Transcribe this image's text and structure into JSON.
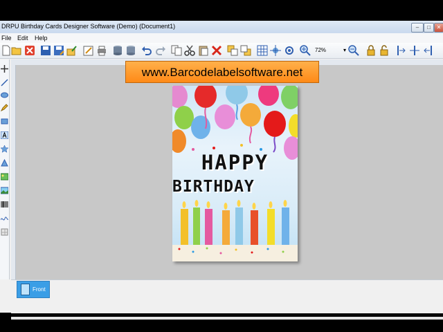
{
  "window": {
    "title": "DRPU Birthday Cards Designer Software (Demo) (Document1)",
    "minimize": "–",
    "maximize": "□",
    "close": "✕"
  },
  "menu": [
    "File",
    "Edit",
    "Help"
  ],
  "toolbar": {
    "zoom_value": "72%",
    "icons": [
      "new-icon",
      "open-icon",
      "close-doc-icon",
      "save-icon",
      "save-as-icon",
      "export-icon",
      "properties-icon",
      "print-icon",
      "database-icon",
      "data-table-icon",
      "undo-icon",
      "redo-icon",
      "copy-icon",
      "cut-icon",
      "paste-icon",
      "delete-icon",
      "bring-front-icon",
      "send-back-icon",
      "grid-icon",
      "center-icon",
      "target-icon",
      "zoom-in-icon",
      "zoom-out-icon",
      "lock-icon",
      "unlock-icon",
      "align-left-icon",
      "align-center-icon",
      "align-right-icon"
    ]
  },
  "banner": {
    "text": "www.Barcodelabelsoftware.net"
  },
  "card": {
    "line1": "HAPPY",
    "line2": "BIRTHDAY"
  },
  "tabs": [
    {
      "label": "Front"
    }
  ],
  "colors": {
    "banner": "#ff9a2a",
    "tab_active": "#3a9ee6",
    "canvas": "#c8c8c8"
  }
}
